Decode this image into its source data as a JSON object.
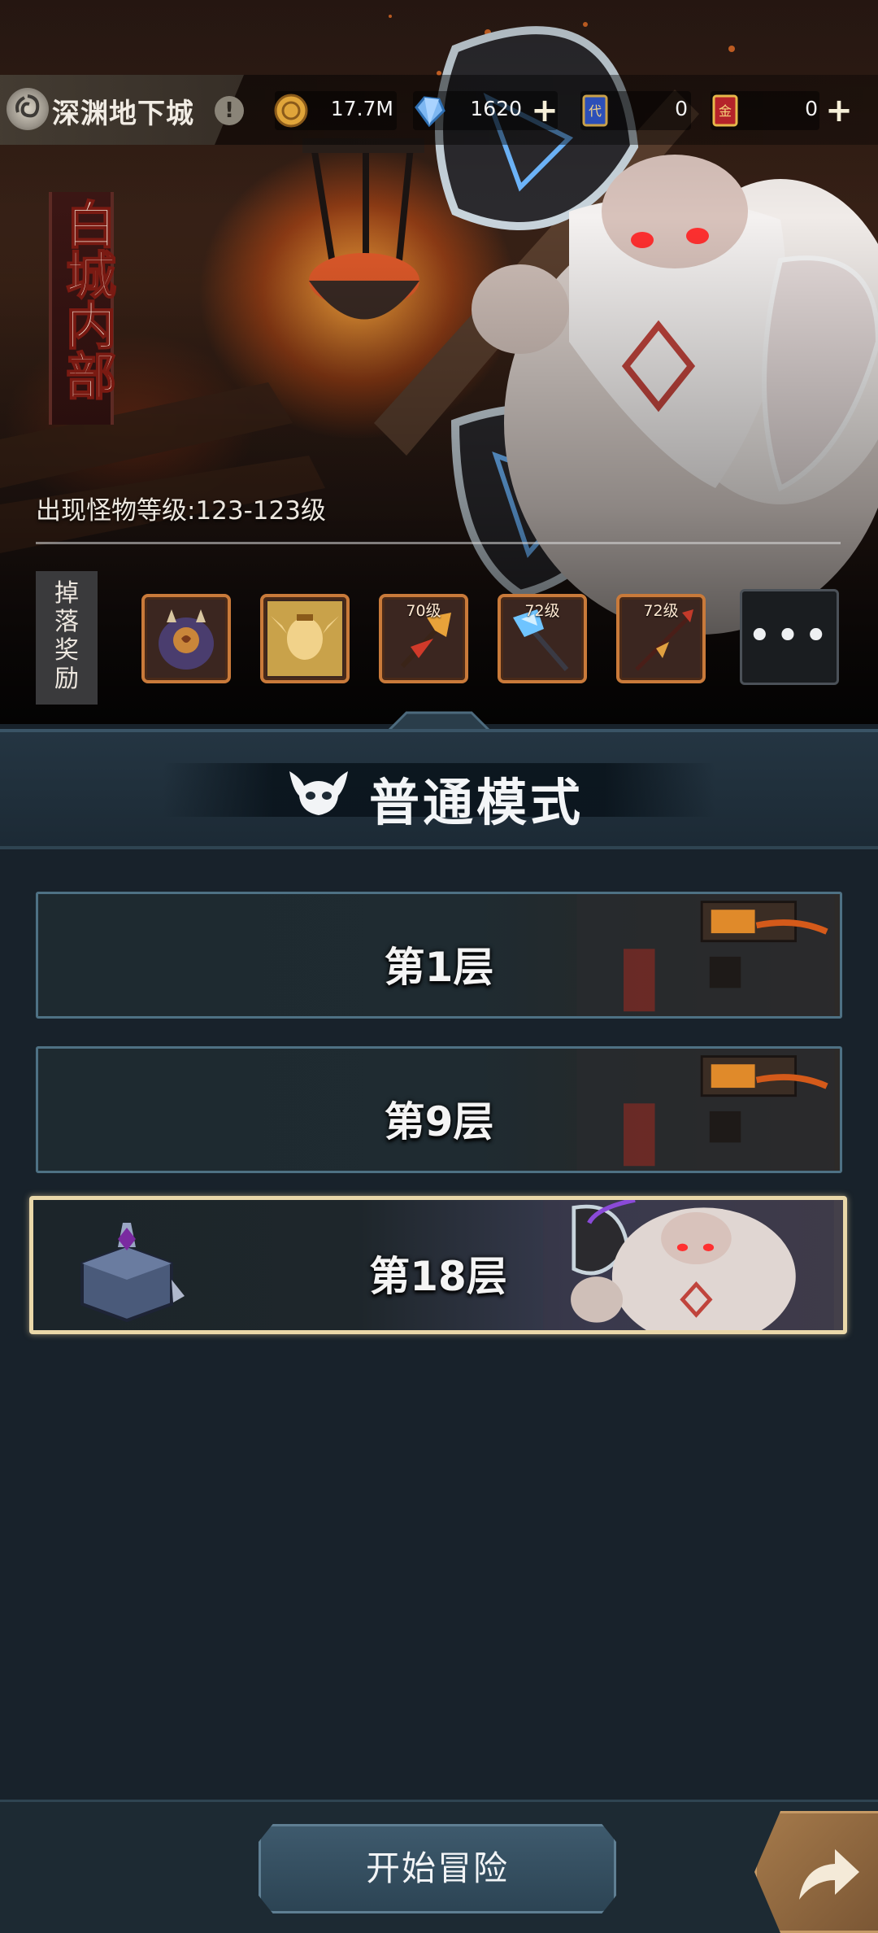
{
  "header": {
    "dungeon_name": "深渊地下城",
    "info_icon": "exclamation-icon",
    "resources": [
      {
        "name": "gold-coin-icon",
        "value": "17.7M",
        "has_plus": false
      },
      {
        "name": "diamond-icon",
        "value": "1620",
        "has_plus": true
      },
      {
        "name": "voucher-card-icon",
        "value": "0",
        "has_plus": false
      },
      {
        "name": "gold-card-icon",
        "value": "0",
        "has_plus": true
      }
    ]
  },
  "hero": {
    "title": "白城内部",
    "monster_level_text": "出现怪物等级:123-123级"
  },
  "drops": {
    "label_chars": [
      "掉",
      "落",
      "奖",
      "励"
    ],
    "items": [
      {
        "icon": "purple-egg-creature-icon",
        "level": ""
      },
      {
        "icon": "golden-elf-hero-icon",
        "level": ""
      },
      {
        "icon": "flame-axe-icon",
        "level": "70级"
      },
      {
        "icon": "ice-axe-icon",
        "level": "72级"
      },
      {
        "icon": "dark-spear-icon",
        "level": "72级"
      }
    ],
    "more_label": "•••"
  },
  "mode": {
    "title": "普通模式",
    "icon": "demon-skull-icon"
  },
  "floors": [
    {
      "label": "第1层",
      "selected": false
    },
    {
      "label": "第9层",
      "selected": false
    },
    {
      "label": "第18层",
      "selected": true,
      "icon": "treasure-chest-icon"
    }
  ],
  "footer": {
    "start_label": "开始冒险",
    "share_icon": "share-arrow-icon"
  }
}
